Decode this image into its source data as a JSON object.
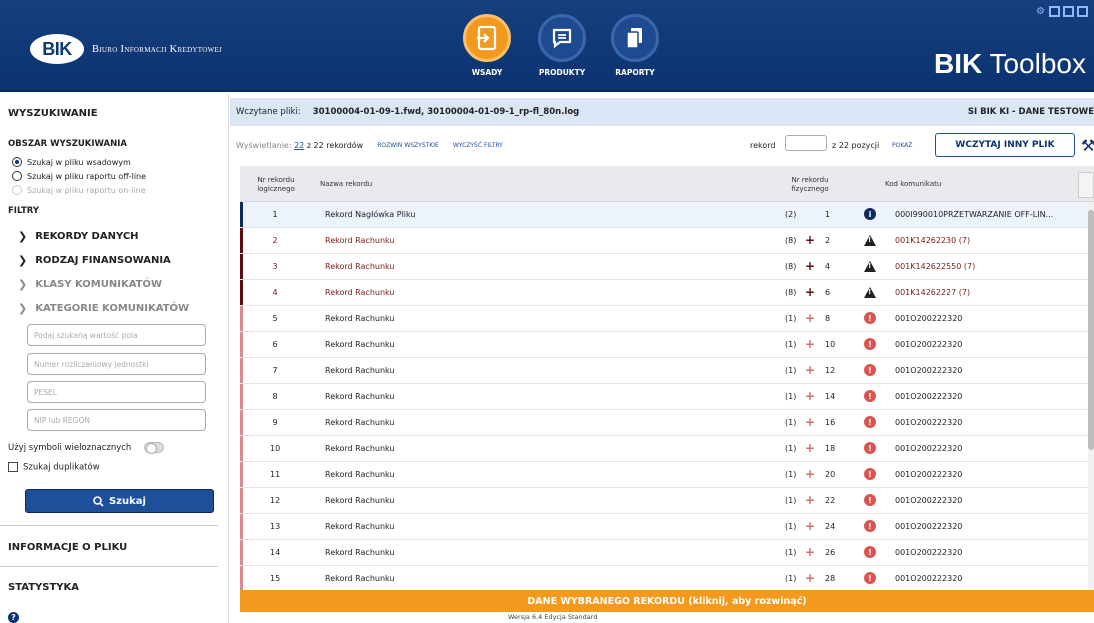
{
  "header": {
    "logo_abbr": "BIK",
    "logo_name": "Biuro Informacji Kredytowej",
    "nav": [
      {
        "label": "WSADY",
        "icon": "import-icon",
        "active": true
      },
      {
        "label": "PRODUKTY",
        "icon": "chat-icon",
        "active": false
      },
      {
        "label": "RAPORTY",
        "icon": "document-icon",
        "active": false
      }
    ],
    "app_title_bold": "BIK",
    "app_title_rest": " Toolbox",
    "window_buttons": [
      "gear-icon",
      "minimize-icon",
      "maximize-icon",
      "close-icon"
    ]
  },
  "sidebar": {
    "search_title": "WYSZUKIWANIE",
    "area_title": "OBSZAR WYSZUKIWANIA",
    "radios": [
      {
        "label": "Szukaj w pliku wsadowym",
        "checked": true,
        "disabled": false
      },
      {
        "label": "Szukaj w pliku raportu off-line",
        "checked": false,
        "disabled": false
      },
      {
        "label": "Szukaj w pliku raportu on-line",
        "checked": false,
        "disabled": true
      }
    ],
    "filters_title": "FILTRY",
    "filters": [
      {
        "label": "REKORDY DANYCH",
        "dim": false
      },
      {
        "label": "RODZAJ FINANSOWANIA",
        "dim": false
      },
      {
        "label": "KLASY KOMUNIKATÓW",
        "dim": true
      },
      {
        "label": "KATEGORIE KOMUNIKATÓW",
        "dim": true
      }
    ],
    "inputs": [
      {
        "placeholder": "Podaj szukaną wartość pola"
      },
      {
        "placeholder": "Numer rozliczeniowy jednostki"
      },
      {
        "placeholder": "PESEL"
      },
      {
        "placeholder": "NIP lub REGON"
      }
    ],
    "wildcard_label": "Użyj symboli wieloznacznych",
    "duplicates_label": "Szukaj duplikatów",
    "search_button": "Szukaj",
    "file_info": "INFORMACJE O PLIKU",
    "stats": "STATYSTYKA"
  },
  "filebar": {
    "label": "Wczytane pliki:",
    "files": "30100004-01-09-1.fwd, 30100004-01-09-1_rp-fl_80n.log",
    "env": "SI BIK KI - DANE TESTOWE"
  },
  "controls": {
    "display_prefix": "Wyświetlanie:",
    "display_count": "22",
    "display_suffix": "z 22 rekordów",
    "expand_all": "ROZWIŃ WSZYSTKIE",
    "clear_filters": "WYCZYŚĆ FILTRY",
    "record_label": "rekord",
    "record_of": "z 22 pozycji",
    "show": "POKAŻ",
    "load_other": "WCZYTAJ INNY PLIK"
  },
  "table": {
    "columns": {
      "logical_1": "Nr rekordu",
      "logical_2": "logicznego",
      "name": "Nazwa rekordu",
      "physical_1": "Nr rekordu",
      "physical_2": "fizycznego",
      "code": "Kod komunikatu"
    },
    "rows": [
      {
        "num": "1",
        "name": "Rekord Nagłówka Pliku",
        "cnt": "(2)",
        "plus": "",
        "phys": "1",
        "status": "info",
        "code": "000I990010PRZETWARZANIE OFF-LIN..."
      },
      {
        "num": "2",
        "name": "Rekord Rachunku",
        "cnt": "(8)",
        "plus": "+",
        "phys": "2",
        "status": "warn",
        "code": "001K14262230 (7)"
      },
      {
        "num": "3",
        "name": "Rekord Rachunku",
        "cnt": "(8)",
        "plus": "+",
        "phys": "4",
        "status": "warn",
        "code": "001K142622550 (7)"
      },
      {
        "num": "4",
        "name": "Rekord Rachunku",
        "cnt": "(8)",
        "plus": "+",
        "phys": "6",
        "status": "warn",
        "code": "001K14262227 (7)"
      },
      {
        "num": "5",
        "name": "Rekord Rachunku",
        "cnt": "(1)",
        "plus": "+",
        "phys": "8",
        "status": "error",
        "code": "001O200222320"
      },
      {
        "num": "6",
        "name": "Rekord Rachunku",
        "cnt": "(1)",
        "plus": "+",
        "phys": "10",
        "status": "error",
        "code": "001O200222320"
      },
      {
        "num": "7",
        "name": "Rekord Rachunku",
        "cnt": "(1)",
        "plus": "+",
        "phys": "12",
        "status": "error",
        "code": "001O200222320"
      },
      {
        "num": "8",
        "name": "Rekord Rachunku",
        "cnt": "(1)",
        "plus": "+",
        "phys": "14",
        "status": "error",
        "code": "001O200222320"
      },
      {
        "num": "9",
        "name": "Rekord Rachunku",
        "cnt": "(1)",
        "plus": "+",
        "phys": "16",
        "status": "error",
        "code": "001O200222320"
      },
      {
        "num": "10",
        "name": "Rekord Rachunku",
        "cnt": "(1)",
        "plus": "+",
        "phys": "18",
        "status": "error",
        "code": "001O200222320"
      },
      {
        "num": "11",
        "name": "Rekord Rachunku",
        "cnt": "(1)",
        "plus": "+",
        "phys": "20",
        "status": "error",
        "code": "001O200222320"
      },
      {
        "num": "12",
        "name": "Rekord Rachunku",
        "cnt": "(1)",
        "plus": "+",
        "phys": "22",
        "status": "error",
        "code": "001O200222320"
      },
      {
        "num": "13",
        "name": "Rekord Rachunku",
        "cnt": "(1)",
        "plus": "+",
        "phys": "24",
        "status": "error",
        "code": "001O200222320"
      },
      {
        "num": "14",
        "name": "Rekord Rachunku",
        "cnt": "(1)",
        "plus": "+",
        "phys": "26",
        "status": "error",
        "code": "001O200222320"
      },
      {
        "num": "15",
        "name": "Rekord Rachunku",
        "cnt": "(1)",
        "plus": "+",
        "phys": "28",
        "status": "error",
        "code": "001O200222320"
      }
    ]
  },
  "bottom_bar": "DANE WYBRANEGO REKORDU (kliknij, aby rozwinąć)",
  "version": "Wersja 6.4 Edycja Standard",
  "colors": {
    "header_bg": "#0f3a78",
    "accent_orange": "#f39a1e",
    "warn_bar": "#5c0f0f",
    "error_bar": "#d98c8c",
    "info_bar": "#0c2a5c"
  }
}
